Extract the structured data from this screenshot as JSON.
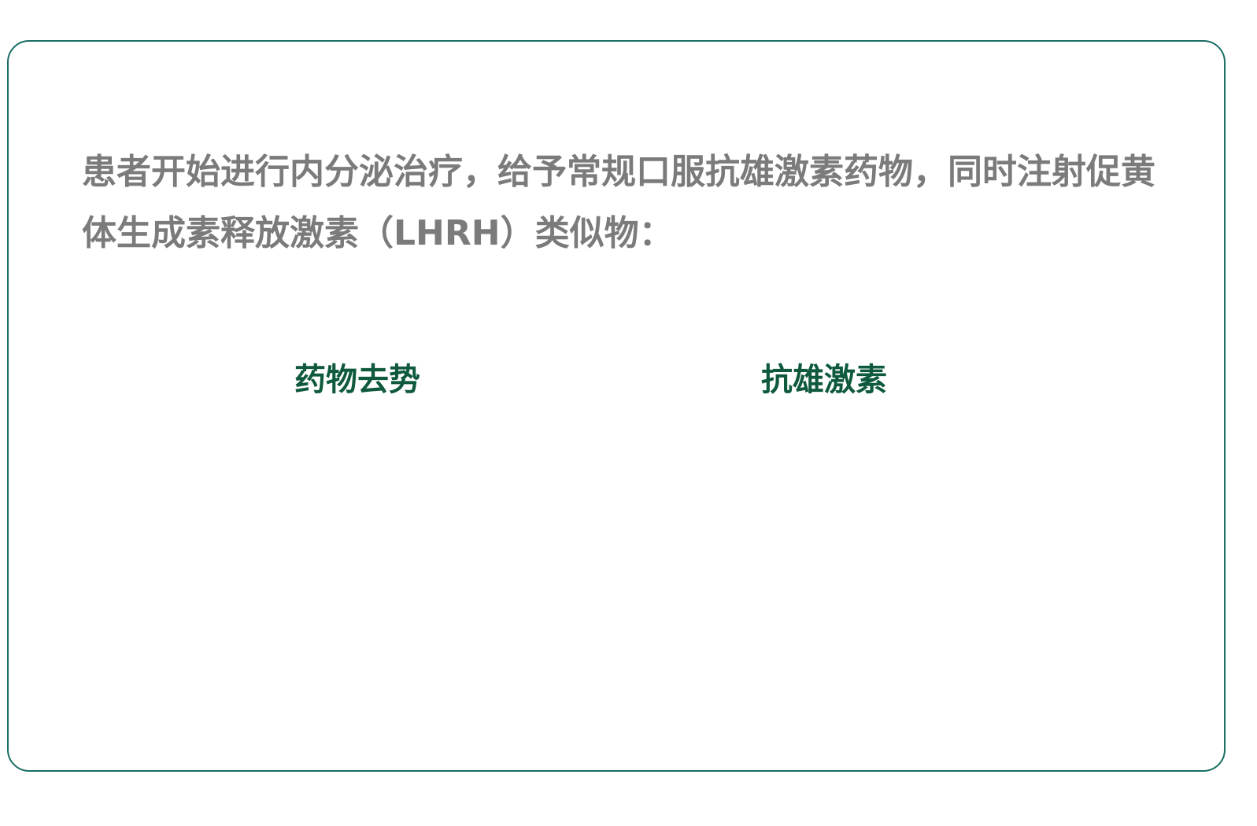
{
  "intro_text": "患者开始进行内分泌治疗，给予常规口服抗雄激素药物，同时注射促黄体生成素释放激素（LHRH）类似物：",
  "options": [
    {
      "label": "药物去势"
    },
    {
      "label": "抗雄激素"
    }
  ],
  "colors": {
    "border": "#1a6e63",
    "intro_text": "#7b7b7b",
    "option_text": "#0f5a3c"
  }
}
